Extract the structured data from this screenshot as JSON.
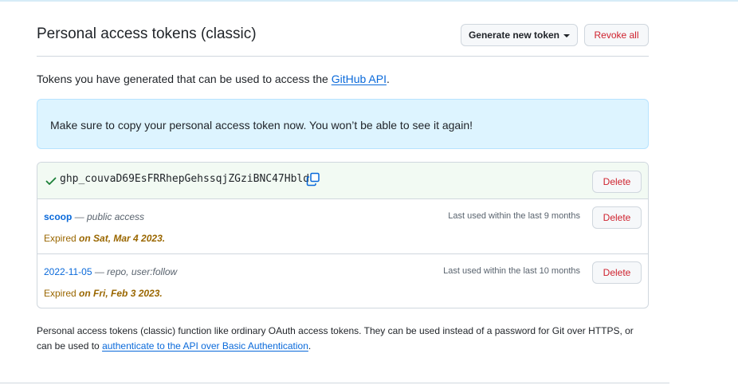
{
  "header": {
    "title": "Personal access tokens (classic)",
    "generate_label": "Generate new token",
    "revoke_label": "Revoke all"
  },
  "intro": {
    "text": "Tokens you have generated that can be used to access the ",
    "link": "GitHub API",
    "suffix": "."
  },
  "flash": {
    "message": "Make sure to copy your personal access token now. You won’t be able to see it again!"
  },
  "new_token": {
    "value": "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",
    "delete_label": "Delete",
    "icons": [
      "check-icon",
      "copy-icon"
    ]
  },
  "tokens": [
    {
      "name": "scoop",
      "scopes": " — public access",
      "last_used": "Last used within the last 9 months",
      "expired_prefix": "Expired ",
      "expired_date": "on Sat, Mar 4 2023.",
      "delete_label": "Delete"
    },
    {
      "name": "2022-11-05",
      "scopes": " — repo, user:follow",
      "last_used": "Last used within the last 10 months",
      "expired_prefix": "Expired ",
      "expired_date": "on Fri, Feb 3 2023.",
      "delete_label": "Delete"
    }
  ],
  "footnote": {
    "text": "Personal access tokens (classic) function like ordinary OAuth access tokens. They can be used instead of a password for Git over HTTPS, or can be used to ",
    "link": "authenticate to the API over Basic Authentication",
    "suffix": "."
  },
  "colors": {
    "link": "#0969da",
    "danger": "#cf222e",
    "warning": "#9a6700",
    "success": "#1a7f37",
    "flash_bg": "#ddf4ff"
  }
}
